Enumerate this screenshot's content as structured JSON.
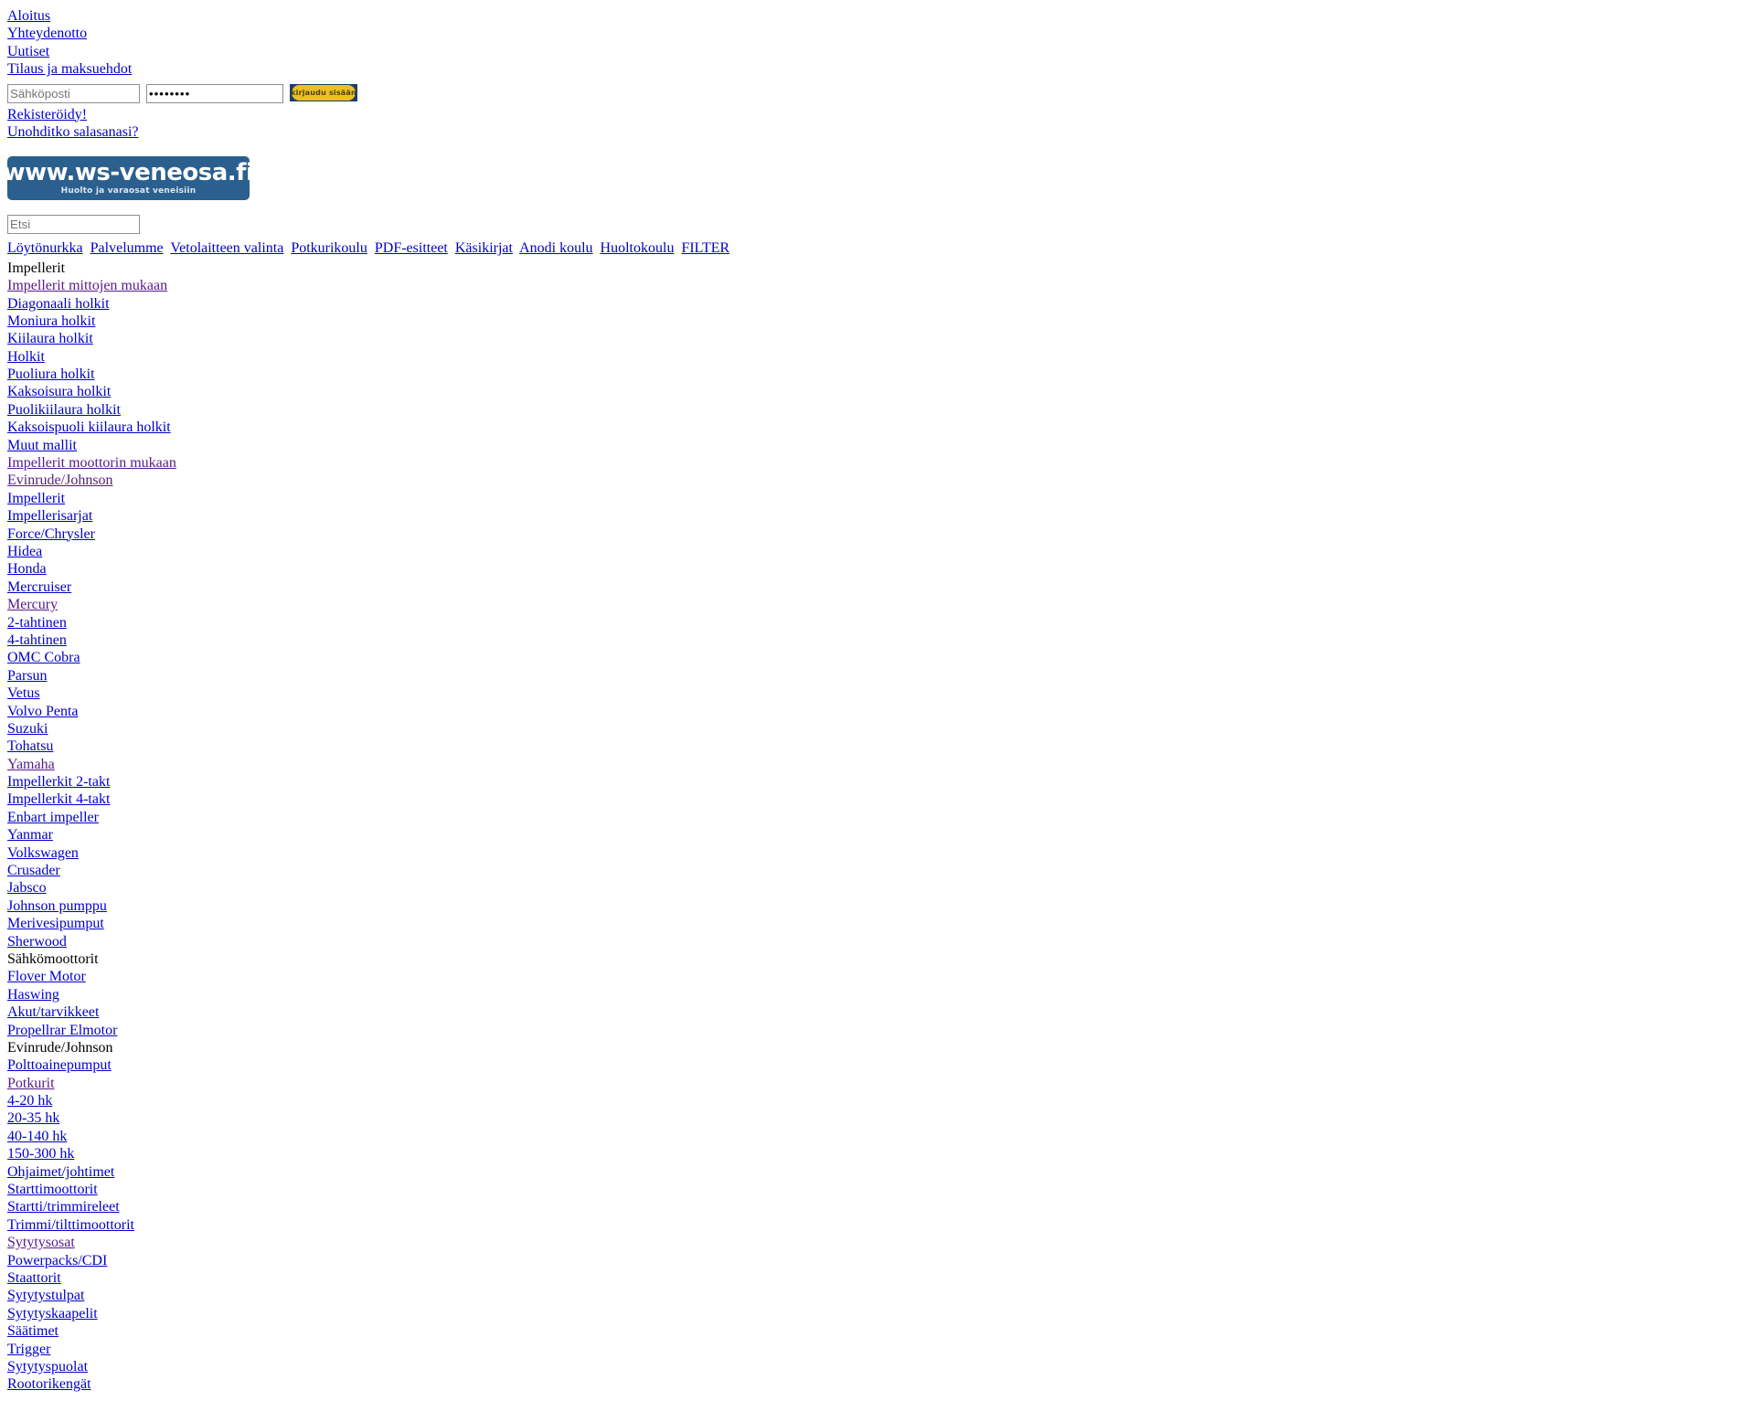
{
  "colors": {
    "link": "#0000cc",
    "visited_link": "#551a8b",
    "logo_bg": "#2b5f8e",
    "button_pill": "#edc01f",
    "button_bg": "#1d3f66",
    "text": "#000000"
  },
  "top_links": [
    {
      "label": "Aloitus"
    },
    {
      "label": "Yhteydenotto"
    },
    {
      "label": "Uutiset"
    },
    {
      "label": "Tilaus ja maksuehdot"
    }
  ],
  "login": {
    "email_placeholder": "Sähköposti",
    "email_value": "",
    "password_value": "••••••••",
    "password_placeholder": "",
    "submit_label": "kirjaudu sisään"
  },
  "after_login_links": [
    {
      "label": "Rekisteröidy!"
    },
    {
      "label": "Unohditko salasanasi?"
    }
  ],
  "logo": {
    "main_text": "www.ws-veneosa.fi",
    "tagline": "Huolto ja varaosat veneisiin"
  },
  "search": {
    "placeholder": "Etsi",
    "value": ""
  },
  "main_nav": [
    {
      "label": "Löytönurkka"
    },
    {
      "label": "Palvelumme"
    },
    {
      "label": "Vetolaitteen valinta"
    },
    {
      "label": "Potkurikoulu"
    },
    {
      "label": "PDF-esitteet"
    },
    {
      "label": "Käsikirjat"
    },
    {
      "label": "Anodi koulu"
    },
    {
      "label": "Huoltokoulu"
    },
    {
      "label": "FILTER"
    }
  ],
  "categories": [
    {
      "label": "Impellerit",
      "type": "heading"
    },
    {
      "label": "Impellerit mittojen mukaan",
      "type": "visited"
    },
    {
      "label": "Diagonaali holkit",
      "type": "link"
    },
    {
      "label": "Moniura holkit",
      "type": "link"
    },
    {
      "label": "Kiilaura holkit",
      "type": "link"
    },
    {
      "label": "Holkit",
      "type": "link"
    },
    {
      "label": "Puoliura holkit",
      "type": "link"
    },
    {
      "label": "Kaksoisura holkit",
      "type": "link"
    },
    {
      "label": "Puolikiilaura holkit",
      "type": "link"
    },
    {
      "label": "Kaksoispuoli kiilaura holkit",
      "type": "link"
    },
    {
      "label": "Muut mallit",
      "type": "link"
    },
    {
      "label": "Impellerit moottorin mukaan",
      "type": "visited"
    },
    {
      "label": "Evinrude/Johnson",
      "type": "visited"
    },
    {
      "label": "Impellerit",
      "type": "link"
    },
    {
      "label": "Impellerisarjat",
      "type": "link"
    },
    {
      "label": "Force/Chrysler",
      "type": "link"
    },
    {
      "label": "Hidea",
      "type": "link"
    },
    {
      "label": "Honda",
      "type": "link"
    },
    {
      "label": "Mercruiser",
      "type": "link"
    },
    {
      "label": "Mercury",
      "type": "visited"
    },
    {
      "label": "2-tahtinen",
      "type": "link"
    },
    {
      "label": "4-tahtinen",
      "type": "link"
    },
    {
      "label": "OMC Cobra",
      "type": "link"
    },
    {
      "label": "Parsun",
      "type": "link"
    },
    {
      "label": "Vetus",
      "type": "link"
    },
    {
      "label": "Volvo Penta",
      "type": "link"
    },
    {
      "label": "Suzuki",
      "type": "link"
    },
    {
      "label": "Tohatsu",
      "type": "link"
    },
    {
      "label": "Yamaha",
      "type": "visited"
    },
    {
      "label": "Impellerkit 2-takt",
      "type": "link"
    },
    {
      "label": "Impellerkit 4-takt",
      "type": "link"
    },
    {
      "label": "Enbart impeller",
      "type": "link"
    },
    {
      "label": "Yanmar",
      "type": "link"
    },
    {
      "label": "Volkswagen",
      "type": "link"
    },
    {
      "label": "Crusader",
      "type": "link"
    },
    {
      "label": "Jabsco",
      "type": "link"
    },
    {
      "label": "Johnson pumppu",
      "type": "link"
    },
    {
      "label": "Merivesipumput",
      "type": "link"
    },
    {
      "label": "Sherwood",
      "type": "link"
    },
    {
      "label": "Sähkömoottorit",
      "type": "heading"
    },
    {
      "label": "Flover Motor",
      "type": "link"
    },
    {
      "label": "Haswing",
      "type": "link"
    },
    {
      "label": "Akut/tarvikkeet",
      "type": "link"
    },
    {
      "label": "Propellrar Elmotor",
      "type": "link"
    },
    {
      "label": "Evinrude/Johnson",
      "type": "heading"
    },
    {
      "label": "Polttoainepumput",
      "type": "link"
    },
    {
      "label": "Potkurit",
      "type": "visited"
    },
    {
      "label": "4-20 hk",
      "type": "link"
    },
    {
      "label": "20-35 hk",
      "type": "link"
    },
    {
      "label": "40-140 hk",
      "type": "link"
    },
    {
      "label": "150-300 hk",
      "type": "link"
    },
    {
      "label": "Ohjaimet/johtimet",
      "type": "link"
    },
    {
      "label": "Starttimoottorit",
      "type": "link"
    },
    {
      "label": "Startti/trimmireleet",
      "type": "link"
    },
    {
      "label": "Trimmi/tilttimoottorit",
      "type": "link"
    },
    {
      "label": "Sytytysosat",
      "type": "visited"
    },
    {
      "label": "Powerpacks/CDI",
      "type": "link"
    },
    {
      "label": "Staattorit",
      "type": "link"
    },
    {
      "label": "Sytytystulpat",
      "type": "link"
    },
    {
      "label": "Sytytyskaapelit",
      "type": "link"
    },
    {
      "label": "Säätimet",
      "type": "link"
    },
    {
      "label": "Trigger",
      "type": "link"
    },
    {
      "label": "Sytytyspuolat",
      "type": "link"
    },
    {
      "label": "Rootorikengät",
      "type": "link"
    }
  ]
}
